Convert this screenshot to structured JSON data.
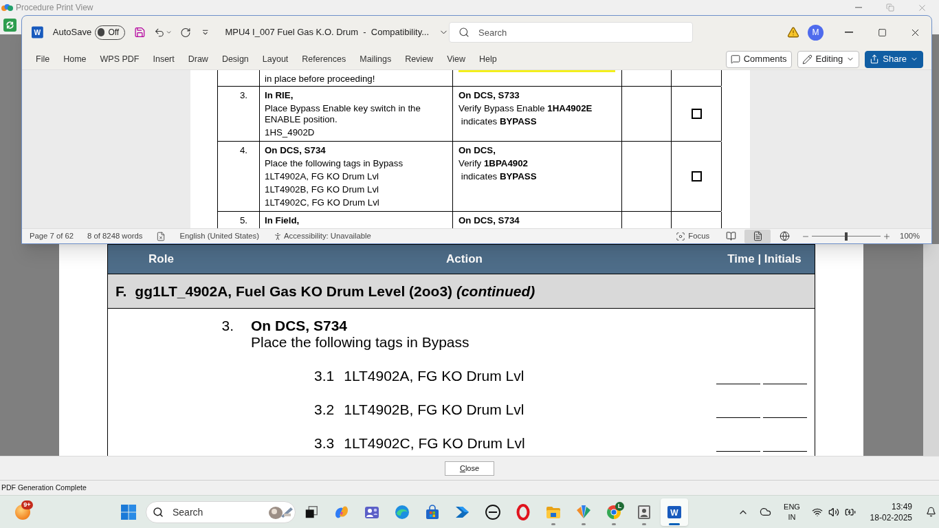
{
  "viewer": {
    "title": "Procedure Print View"
  },
  "word": {
    "icon_letter": "W",
    "autosave": {
      "label": "AutoSave",
      "state_text": "Off",
      "on": false
    },
    "document_title": "MPU4 I_007 Fuel Gas K.O. Drum  -  Compatibility...",
    "search": {
      "placeholder": "Search"
    },
    "avatar": "M",
    "ribbon_tabs": [
      "File",
      "Home",
      "WPS PDF",
      "Insert",
      "Draw",
      "Design",
      "Layout",
      "References",
      "Mailings",
      "Review",
      "View",
      "Help"
    ],
    "ribbon_buttons": {
      "comments": "Comments",
      "editing": "Editing",
      "share": "Share"
    },
    "document": {
      "rows": [
        {
          "kind": "partial",
          "action_lines": [
            "in place before proceeding!"
          ],
          "result_highlighted": true
        },
        {
          "kind": "step",
          "number": "3.",
          "action_heading": "In RIE,",
          "action_lines": [
            "Place Bypass Enable key switch in the ENABLE position.",
            "1HS_4902D"
          ],
          "result_heading": "On DCS, S733",
          "result_lines": [
            "Verify Bypass Enable **1HA4902E**",
            " indicates **BYPASS**"
          ],
          "checked": false
        },
        {
          "kind": "step",
          "number": "4.",
          "action_heading": "On DCS, S734",
          "action_lines": [
            "Place the following tags in Bypass",
            "1LT4902A, FG KO Drum Lvl",
            "1LT4902B, FG KO Drum Lvl",
            "1LT4902C, FG KO Drum Lvl"
          ],
          "result_heading": "On DCS,",
          "result_lines": [
            "Verify **1BPA4902**",
            " indicates **BYPASS**"
          ],
          "checked": false
        },
        {
          "kind": "step",
          "number": "5.",
          "action_heading": "In Field,",
          "result_heading": "On DCS, S734"
        }
      ]
    },
    "status_bar": {
      "page": "Page 7 of 62",
      "words": "8 of 8248 words",
      "language": "English (United States)",
      "accessibility": "Accessibility: Unavailable",
      "focus": "Focus",
      "views": [
        {
          "kind": "read",
          "selected": false
        },
        {
          "kind": "print",
          "selected": true
        },
        {
          "kind": "web",
          "selected": false
        }
      ],
      "zoom": {
        "level": 0.5,
        "reading": "100%"
      }
    }
  },
  "print_view": {
    "header": {
      "role": "Role",
      "action": "Action",
      "time_initials": "Time | Initials"
    },
    "section": {
      "letter": "F.",
      "title": "gg1LT_4902A, Fuel Gas KO Drum Level (2oo3) *(continued)*"
    },
    "step": {
      "number": "3.",
      "heading": "On DCS, S734",
      "instruction": "Place the following tags in Bypass",
      "substeps": [
        {
          "number": "3.1",
          "text": "1LT4902A, FG KO Drum Lvl"
        },
        {
          "number": "3.2",
          "text": "1LT4902B, FG KO Drum Lvl"
        },
        {
          "number": "3.3",
          "text": "1LT4902C, FG KO Drum Lvl"
        }
      ]
    }
  },
  "close_button": "Close",
  "status": "PDF Generation Complete",
  "taskbar": {
    "weather_badge": "9+",
    "search": {
      "placeholder": "Search"
    },
    "apps": [
      {
        "kind": "squares",
        "running": false,
        "selected": false
      },
      {
        "kind": "swirl",
        "running": false,
        "selected": false
      },
      {
        "kind": "people",
        "running": false,
        "selected": false
      },
      {
        "kind": "wave",
        "running": false,
        "selected": false
      },
      {
        "kind": "bag",
        "running": false,
        "selected": false
      },
      {
        "kind": "arrow",
        "running": false,
        "selected": false
      },
      {
        "kind": "ring-logo",
        "running": false,
        "selected": false
      },
      {
        "kind": "red-ring",
        "running": false,
        "selected": false
      },
      {
        "kind": "folder",
        "running": true,
        "selected": false
      },
      {
        "kind": "fan",
        "running": true,
        "selected": false
      },
      {
        "kind": "tri-circle",
        "badge": "L",
        "running": true,
        "selected": false
      },
      {
        "kind": "portrait",
        "running": true,
        "selected": false
      },
      {
        "kind": "document",
        "letter": "W",
        "running": true,
        "selected": true
      }
    ],
    "tray": {
      "language": "ENG",
      "region": "IN",
      "time": "13:49",
      "date": "18-02-2025"
    }
  }
}
